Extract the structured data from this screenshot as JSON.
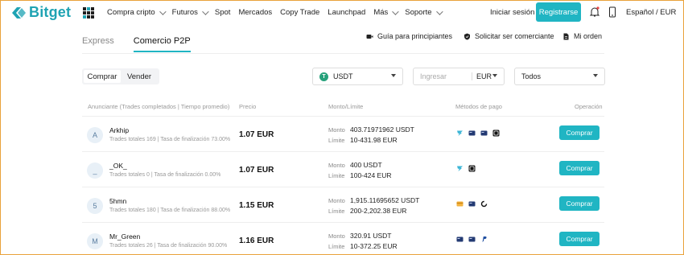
{
  "brand": {
    "name": "Bitget",
    "accent": "#20b5c3"
  },
  "nav": {
    "items": [
      {
        "label": "Compra cripto",
        "dropdown": true
      },
      {
        "label": "Futuros",
        "dropdown": true
      },
      {
        "label": "Spot",
        "dropdown": false
      },
      {
        "label": "Mercados",
        "dropdown": false
      },
      {
        "label": "Copy Trade",
        "dropdown": false
      },
      {
        "label": "Launchpad",
        "dropdown": false
      },
      {
        "label": "Más",
        "dropdown": true
      },
      {
        "label": "Soporte",
        "dropdown": true
      }
    ],
    "login": "Iniciar sesión",
    "register": "Registrarse",
    "language": "Español / EUR"
  },
  "subheader": {
    "tabs": [
      {
        "label": "Express",
        "active": false
      },
      {
        "label": "Comercio P2P",
        "active": true
      }
    ],
    "links": [
      {
        "label": "Guía para principiantes",
        "icon": "video-icon"
      },
      {
        "label": "Solicitar ser comerciante",
        "icon": "shield-icon"
      },
      {
        "label": "Mi orden",
        "icon": "document-icon"
      }
    ]
  },
  "filters": {
    "toggle": {
      "buy": "Comprar",
      "sell": "Vender"
    },
    "asset": "USDT",
    "amount_placeholder": "Ingresar",
    "currency": "EUR",
    "payment": "Todos"
  },
  "table": {
    "headers": {
      "advertiser": "Anunciante (Trades completados | Tiempo promedio)",
      "price": "Precio",
      "amount": "Monto/Límite",
      "payment": "Métodos de pago",
      "operation": "Operación"
    },
    "amount_label": "Monto",
    "limit_label": "Límite",
    "rows": [
      {
        "initial": "A",
        "name": "Arkhip",
        "stats": "Trades totales 169 | Tasa de finalización 73.00%",
        "price": "1.07 EUR",
        "amount": "403.71971962 USDT",
        "limit": "10-431.98 EUR",
        "methods": [
          "wise-icon",
          "bank-card-icon",
          "bank-card-icon",
          "revolut-icon"
        ],
        "action": "Comprar"
      },
      {
        "initial": "_",
        "name": "_OK_",
        "stats": "Trades totales 0 | Tasa de finalización 0.00%",
        "price": "1.07 EUR",
        "amount": "400 USDT",
        "limit": "100-424 EUR",
        "methods": [
          "wise-icon",
          "revolut-icon"
        ],
        "action": "Comprar"
      },
      {
        "initial": "5",
        "name": "5hmn",
        "stats": "Trades totales 180 | Tasa de finalización 88.00%",
        "price": "1.15 EUR",
        "amount": "1,915.11695652 USDT",
        "limit": "200-2,202.38 EUR",
        "methods": [
          "card-icon",
          "bank-card-icon",
          "ring-icon"
        ],
        "action": "Comprar"
      },
      {
        "initial": "M",
        "name": "Mr_Green",
        "stats": "Trades totales 26 | Tasa de finalización 90.00%",
        "price": "1.16 EUR",
        "amount": "320.91 USDT",
        "limit": "10-372.25 EUR",
        "methods": [
          "bank-card-icon",
          "bank-card-icon",
          "paypal-icon"
        ],
        "action": "Comprar"
      }
    ]
  }
}
